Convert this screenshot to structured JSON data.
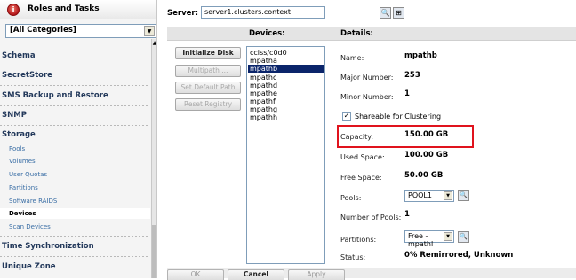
{
  "left_panel": {
    "title": "Roles and Tasks",
    "category_select": "[All Categories]",
    "categories": {
      "schema": "Schema",
      "secretstore": "SecretStore",
      "sms": "SMS Backup and Restore",
      "snmp": "SNMP",
      "storage": "Storage",
      "time_sync": "Time Synchronization",
      "unique_zone": "Unique Zone"
    },
    "storage_items": {
      "pools": "Pools",
      "volumes": "Volumes",
      "user_quotas": "User Quotas",
      "partitions": "Partitions",
      "software_raids": "Software RAIDS",
      "devices": "Devices",
      "scan_devices": "Scan Devices"
    }
  },
  "server": {
    "label": "Server:",
    "value": "server1.clusters.context"
  },
  "columns": {
    "devices": "Devices:",
    "details": "Details:"
  },
  "actions": {
    "initialize_disk": "Initialize Disk",
    "multipath": "Multipath ...",
    "set_default_path": "Set Default Path",
    "reset_registry": "Reset Registry"
  },
  "devices": [
    "cciss/c0d0",
    "mpatha",
    "mpathb",
    "mpathc",
    "mpathd",
    "mpathe",
    "mpathf",
    "mpathg",
    "mpathh"
  ],
  "selected_device": "mpathb",
  "details": {
    "name_label": "Name:",
    "name_value": "mpathb",
    "major_label": "Major Number:",
    "major_value": "253",
    "minor_label": "Minor Number:",
    "minor_value": "1",
    "shareable_label": "Shareable for Clustering",
    "capacity_label": "Capacity:",
    "capacity_value": "150.00 GB",
    "used_label": "Used Space:",
    "used_value": "100.00 GB",
    "free_label": "Free Space:",
    "free_value": "50.00 GB",
    "pools_label": "Pools:",
    "pools_value": "POOL1",
    "num_pools_label": "Number of Pools:",
    "num_pools_value": "1",
    "partitions_label": "Partitions:",
    "partitions_value": "Free - mpathl",
    "status_label": "Status:",
    "status_value": "0% Remirrored, Unknown"
  },
  "bottom": {
    "ok": "OK",
    "cancel": "Cancel",
    "apply": "Apply"
  },
  "icons": {
    "roles": "roles-info-icon",
    "search": "search-icon",
    "browse": "tree-browse-icon",
    "dropdown": "chevron-down-icon"
  }
}
